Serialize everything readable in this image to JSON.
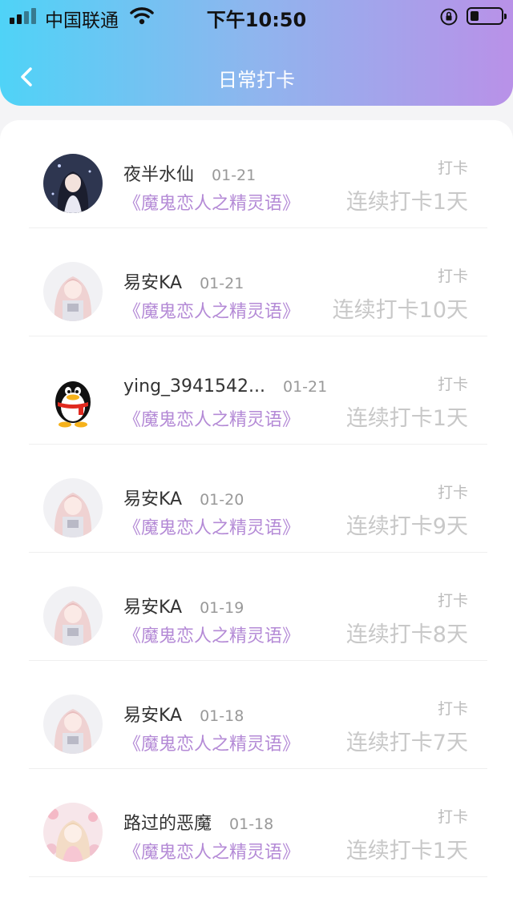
{
  "status_bar": {
    "carrier": "中国联通",
    "time": "下午10:50"
  },
  "header": {
    "title": "日常打卡"
  },
  "colors": {
    "header_gradient_start": "#4fd3f7",
    "header_gradient_end": "#b991e8",
    "book_title": "#b48ad6"
  },
  "checkins": [
    {
      "name": "夜半水仙",
      "date": "01-21",
      "book": "《魔鬼恋人之精灵语》",
      "label": "打卡",
      "streak": "连续打卡1天",
      "avatar": "anime-girl-dark"
    },
    {
      "name": "易安KA",
      "date": "01-21",
      "book": "《魔鬼恋人之精灵语》",
      "label": "打卡",
      "streak": "连续打卡10天",
      "avatar": "anime-girl-pink"
    },
    {
      "name": "ying_3941542...",
      "date": "01-21",
      "book": "《魔鬼恋人之精灵语》",
      "label": "打卡",
      "streak": "连续打卡1天",
      "avatar": "penguin"
    },
    {
      "name": "易安KA",
      "date": "01-20",
      "book": "《魔鬼恋人之精灵语》",
      "label": "打卡",
      "streak": "连续打卡9天",
      "avatar": "anime-girl-pink"
    },
    {
      "name": "易安KA",
      "date": "01-19",
      "book": "《魔鬼恋人之精灵语》",
      "label": "打卡",
      "streak": "连续打卡8天",
      "avatar": "anime-girl-pink"
    },
    {
      "name": "易安KA",
      "date": "01-18",
      "book": "《魔鬼恋人之精灵语》",
      "label": "打卡",
      "streak": "连续打卡7天",
      "avatar": "anime-girl-pink"
    },
    {
      "name": "路过的恶魔",
      "date": "01-18",
      "book": "《魔鬼恋人之精灵语》",
      "label": "打卡",
      "streak": "连续打卡1天",
      "avatar": "anime-girl-flowers"
    }
  ]
}
